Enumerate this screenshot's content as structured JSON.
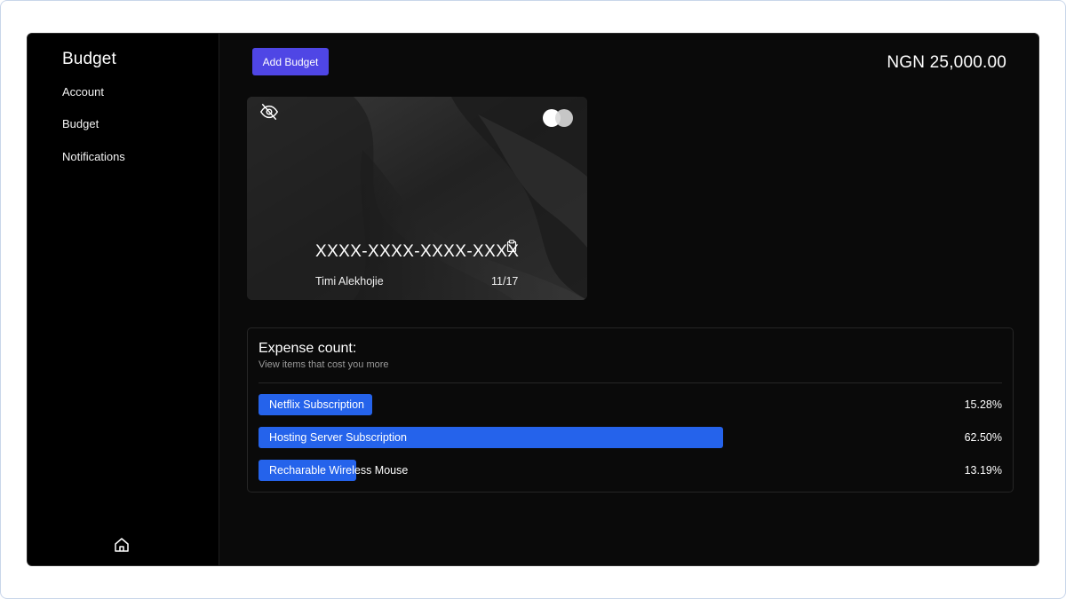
{
  "sidebar": {
    "title": "Budget",
    "items": [
      {
        "label": "Account"
      },
      {
        "label": "Budget"
      },
      {
        "label": "Notifications"
      }
    ],
    "footer_icon": "home-icon"
  },
  "header": {
    "add_budget_label": "Add Budget",
    "balance": "NGN 25,000.00"
  },
  "card": {
    "number": "XXXX-XXXX-XXXX-XXXX",
    "holder": "Timi Alekhojie",
    "expiry": "11/17",
    "visibility_icon": "eye-off-icon",
    "copy_icon": "clipboard-icon",
    "brand_icon": "card-brand-icon"
  },
  "expenses": {
    "title": "Expense count:",
    "subtitle": "View items that cost you more",
    "items": [
      {
        "label": "Netflix Subscription",
        "percent_text": "15.28%",
        "percent": 15.28
      },
      {
        "label": "Hosting Server Subscription",
        "percent_text": "62.50%",
        "percent": 62.5
      },
      {
        "label": "Recharable Wireless Mouse",
        "percent_text": "13.19%",
        "percent": 13.19
      }
    ]
  },
  "colors": {
    "accent_button": "#4f46e5",
    "bar_fill": "#2563eb",
    "background": "#0a0a0a"
  }
}
